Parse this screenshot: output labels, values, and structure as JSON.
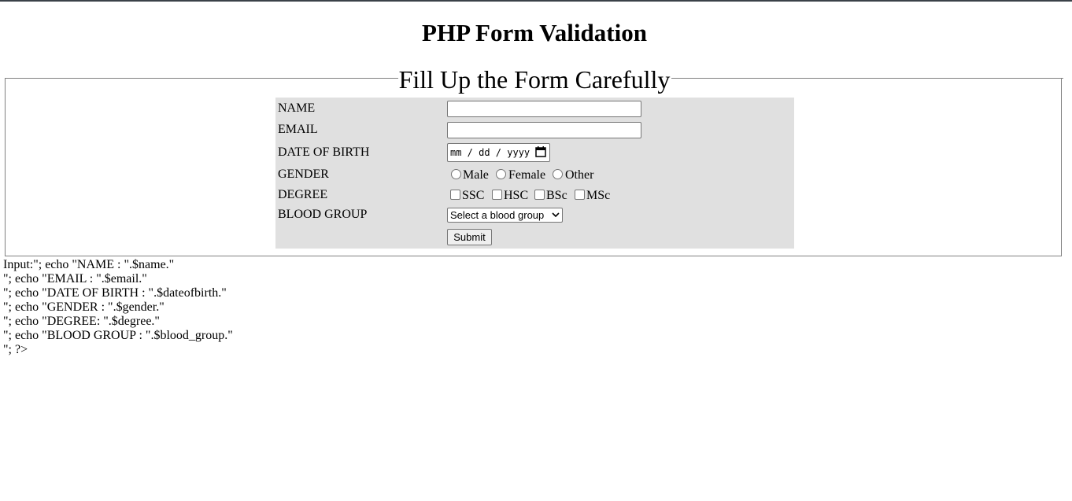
{
  "page": {
    "heading": "PHP Form Validation",
    "legend": "Fill Up the Form Carefully"
  },
  "form": {
    "name_label": "NAME",
    "email_label": "EMAIL",
    "dob_label": "DATE OF BIRTH",
    "dob_placeholder": "mm / dd / yyyy",
    "gender_label": "GENDER",
    "gender_options": [
      "Male",
      "Female",
      "Other"
    ],
    "degree_label": "DEGREE",
    "degree_options": [
      "SSC",
      "HSC",
      "BSc",
      "MSc"
    ],
    "blood_group_label": "BLOOD GROUP",
    "blood_group_selected": "Select a blood group",
    "submit_label": "Submit",
    "icons": {
      "date": "calendar-icon",
      "select": "chevron-down-icon"
    }
  },
  "raw_output": [
    "Input:\"; echo \"NAME : \".$name.\"",
    "\"; echo \"EMAIL : \".$email.\"",
    "\"; echo \"DATE OF BIRTH : \".$dateofbirth.\"",
    "\"; echo \"GENDER : \".$gender.\"",
    "\"; echo \"DEGREE: \".$degree.\"",
    "\"; echo \"BLOOD GROUP : \".$blood_group.\"",
    "\"; ?>"
  ]
}
